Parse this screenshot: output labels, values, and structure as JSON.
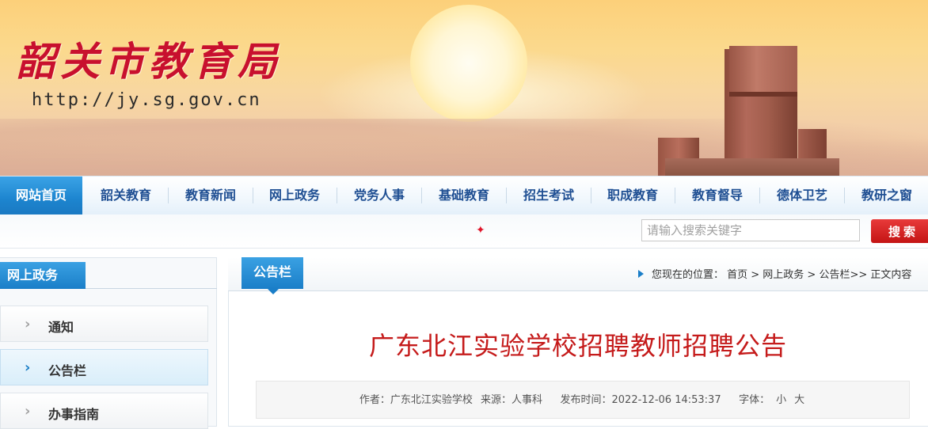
{
  "header": {
    "site_title": "韶关市教育局",
    "site_url": "http://jy.sg.gov.cn"
  },
  "nav": {
    "items": [
      {
        "label": "网站首页"
      },
      {
        "label": "韶关教育"
      },
      {
        "label": "教育新闻"
      },
      {
        "label": "网上政务"
      },
      {
        "label": "党务人事"
      },
      {
        "label": "基础教育"
      },
      {
        "label": "招生考试"
      },
      {
        "label": "职成教育"
      },
      {
        "label": "教育督导"
      },
      {
        "label": "德体卫艺"
      },
      {
        "label": "教研之窗"
      }
    ]
  },
  "search": {
    "placeholder": "请输入搜索关键字",
    "button_label": "搜索"
  },
  "sidebar": {
    "heading": "网上政务",
    "items": [
      {
        "label": "通知"
      },
      {
        "label": "公告栏"
      },
      {
        "label": "办事指南"
      }
    ],
    "active_item": "公告栏"
  },
  "main": {
    "tab_label": "公告栏",
    "breadcrumb": "您现在的位置： 首页 > 网上政务 > 公告栏>> 正文内容",
    "article_title": "广东北江实验学校招聘教师招聘公告",
    "meta": {
      "author": "作者：广东北江实验学校",
      "source": "来源：人事科",
      "published": "发布时间：2022-12-06 14:53:37",
      "font_label": "字体：",
      "font_small": "小",
      "font_large": "大"
    }
  },
  "colors": {
    "accent_blue": "#1a7ec8",
    "title_red": "#c51b1b",
    "search_red": "#c41414"
  }
}
